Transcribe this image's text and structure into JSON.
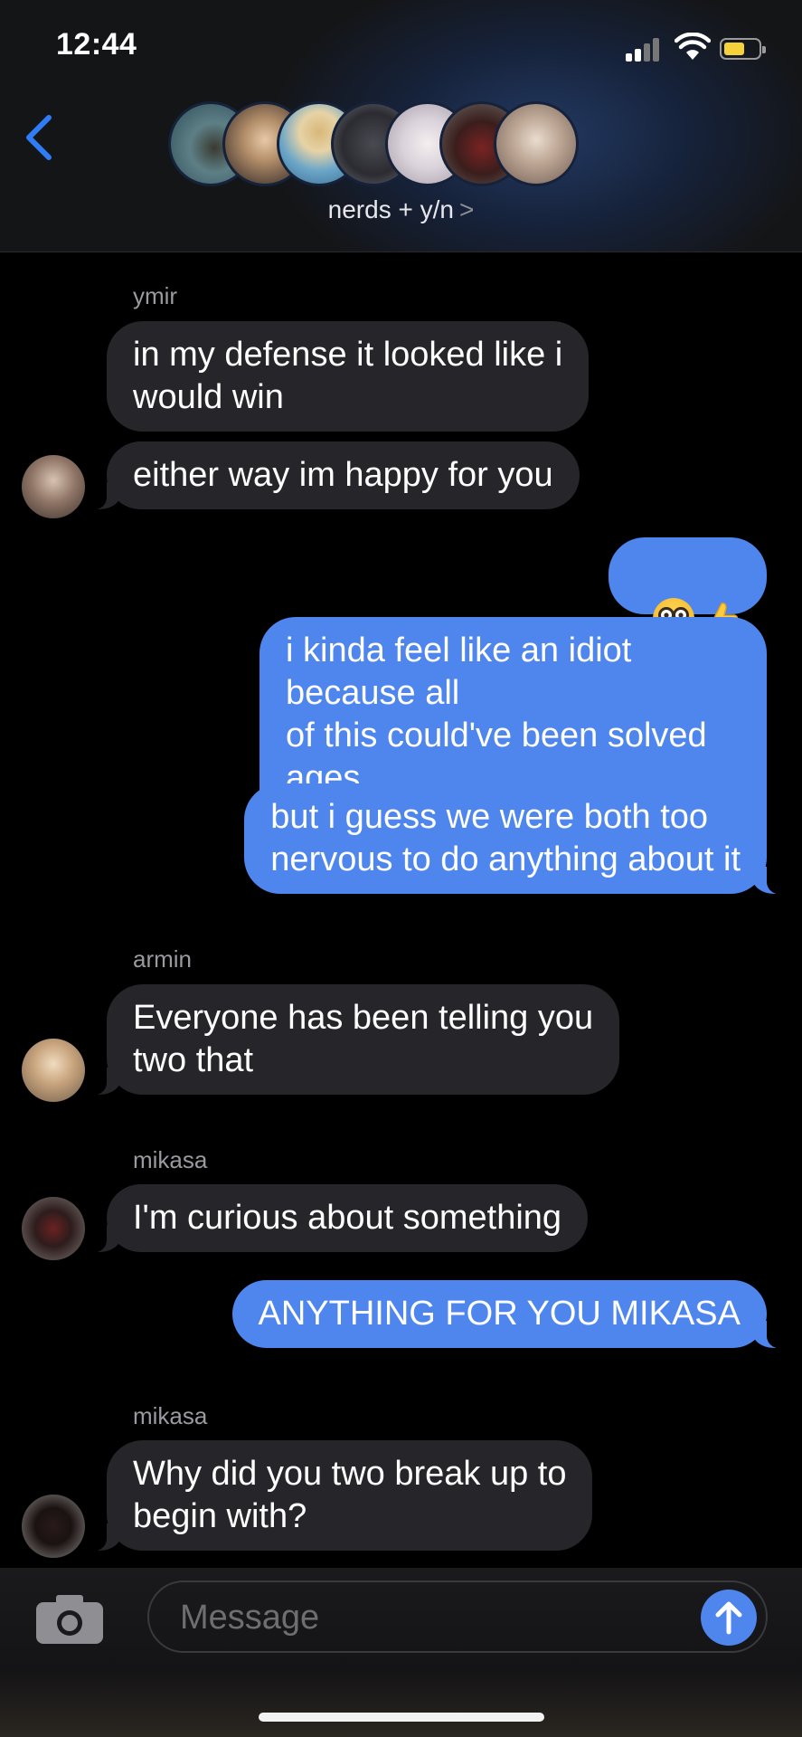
{
  "status_bar": {
    "time": "12:44",
    "battery_color": "#f5d13a"
  },
  "header": {
    "group_name": "nerds + y/n",
    "chevron": ">",
    "back_icon": "chevron-left-icon",
    "avatars": [
      "avatar-1",
      "avatar-2",
      "avatar-3",
      "avatar-4",
      "avatar-5",
      "avatar-6",
      "avatar-7"
    ]
  },
  "messages": [
    {
      "sender": "ymir"
    },
    {
      "text": "in my defense it looked like i\nwould win"
    },
    {
      "text": "either way im happy for you"
    },
    {
      "emojis": [
        "nerd-face-icon",
        "thumbs-up-icon"
      ]
    },
    {
      "text": "i kinda feel like an idiot because all\nof this could've been solved ages\nago"
    },
    {
      "text": "but i guess we were both too\nnervous to do anything about it"
    },
    {
      "sender": "armin"
    },
    {
      "text": "Everyone has been telling you\ntwo that"
    },
    {
      "sender": "mikasa"
    },
    {
      "text": "I'm curious about something"
    },
    {
      "text": "ANYTHING FOR YOU MIKASA"
    },
    {
      "sender": "mikasa"
    },
    {
      "text": "Why did you two break up to\nbegin with?"
    }
  ],
  "composer": {
    "placeholder": "Message"
  },
  "colors": {
    "incoming": "#26252a",
    "outgoing": "#4f86ee",
    "accent": "#2f7cf6"
  }
}
